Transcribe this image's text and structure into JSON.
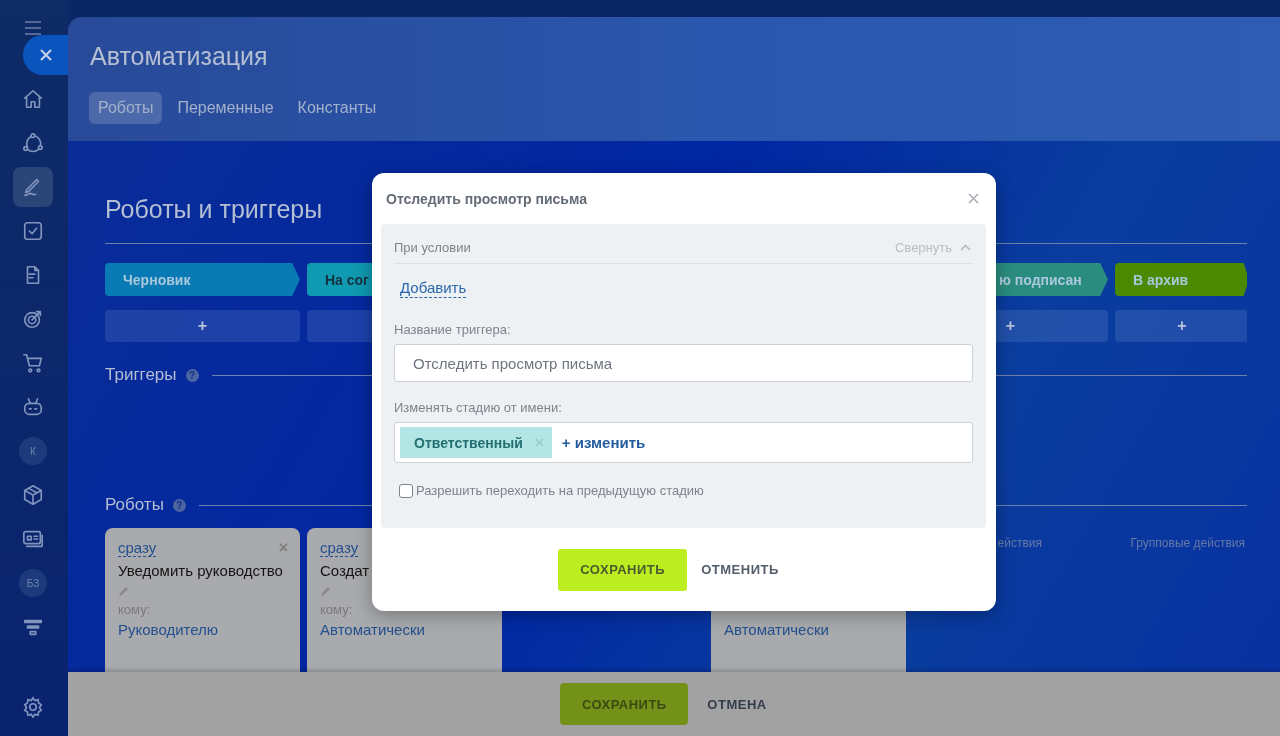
{
  "sidebar": {
    "items": [
      {
        "kind": "icon",
        "selected": false
      },
      {
        "kind": "icon",
        "selected": false
      },
      {
        "kind": "icon",
        "selected": true
      },
      {
        "kind": "icon",
        "selected": false
      },
      {
        "kind": "icon",
        "selected": false
      },
      {
        "kind": "icon",
        "selected": false
      },
      {
        "kind": "icon",
        "selected": false
      },
      {
        "kind": "icon",
        "selected": false
      },
      {
        "kind": "avatar",
        "label": "К",
        "selected": false
      },
      {
        "kind": "icon",
        "selected": false
      },
      {
        "kind": "icon",
        "selected": false
      },
      {
        "kind": "avatar",
        "label": "БЗ",
        "selected": false
      },
      {
        "kind": "icon",
        "selected": false
      }
    ]
  },
  "page": {
    "title": "Автоматизация",
    "tabs": [
      {
        "label": "Роботы",
        "selected": true
      },
      {
        "label": "Переменные",
        "selected": false
      },
      {
        "label": "Константы",
        "selected": false
      }
    ]
  },
  "heading": "Роботы и триггеры",
  "stages": [
    {
      "name": "Черновик",
      "color": "#0a7ab4",
      "add": "+"
    },
    {
      "name": "На сог",
      "color": "#0f9ab2"
    }
  ],
  "stages_right": [
    {
      "name": "ю подписан",
      "color": "#2a8c7e",
      "add": "+"
    },
    {
      "name": "В архив",
      "color": "#4b8a00",
      "add": "+"
    }
  ],
  "triggers": {
    "title": "Триггеры",
    "help": "?"
  },
  "robots": {
    "title": "Роботы",
    "help": "?",
    "columns": [
      {
        "cards": [
          {
            "delay": "сразу",
            "close": "×",
            "title": "Уведомить руководство",
            "to_label": "кому:",
            "to": "Руководителю"
          }
        ]
      },
      {
        "cards": [
          {
            "delay": "сразу",
            "title": "Создат",
            "to_label": "кому:",
            "to": "Автоматически"
          }
        ]
      },
      {},
      {
        "cards": [
          {
            "to": "Автоматически"
          }
        ]
      },
      {
        "group_actions": "ействия"
      },
      {
        "group_actions": "Групповые действия"
      }
    ]
  },
  "bottom_bar": {
    "save": "СОХРАНИТЬ",
    "cancel": "ОТМЕНА"
  },
  "modal": {
    "title": "Отследить просмотр письма",
    "condition": {
      "label": "При условии",
      "toggle": "Свернуть",
      "expanded": true
    },
    "add_link": "Добавить",
    "name_label": "Название триггера:",
    "name_value": "Отследить просмотр письма",
    "user_label": "Изменять стадию от имени:",
    "user_tag": "Ответственный",
    "change_link": "+ изменить",
    "allow_back": {
      "label": "Разрешить переходить на предыдущую стадию",
      "checked": false
    },
    "buttons": {
      "save": "СОХРАНИТЬ",
      "cancel": "ОТМЕНИТЬ"
    }
  }
}
